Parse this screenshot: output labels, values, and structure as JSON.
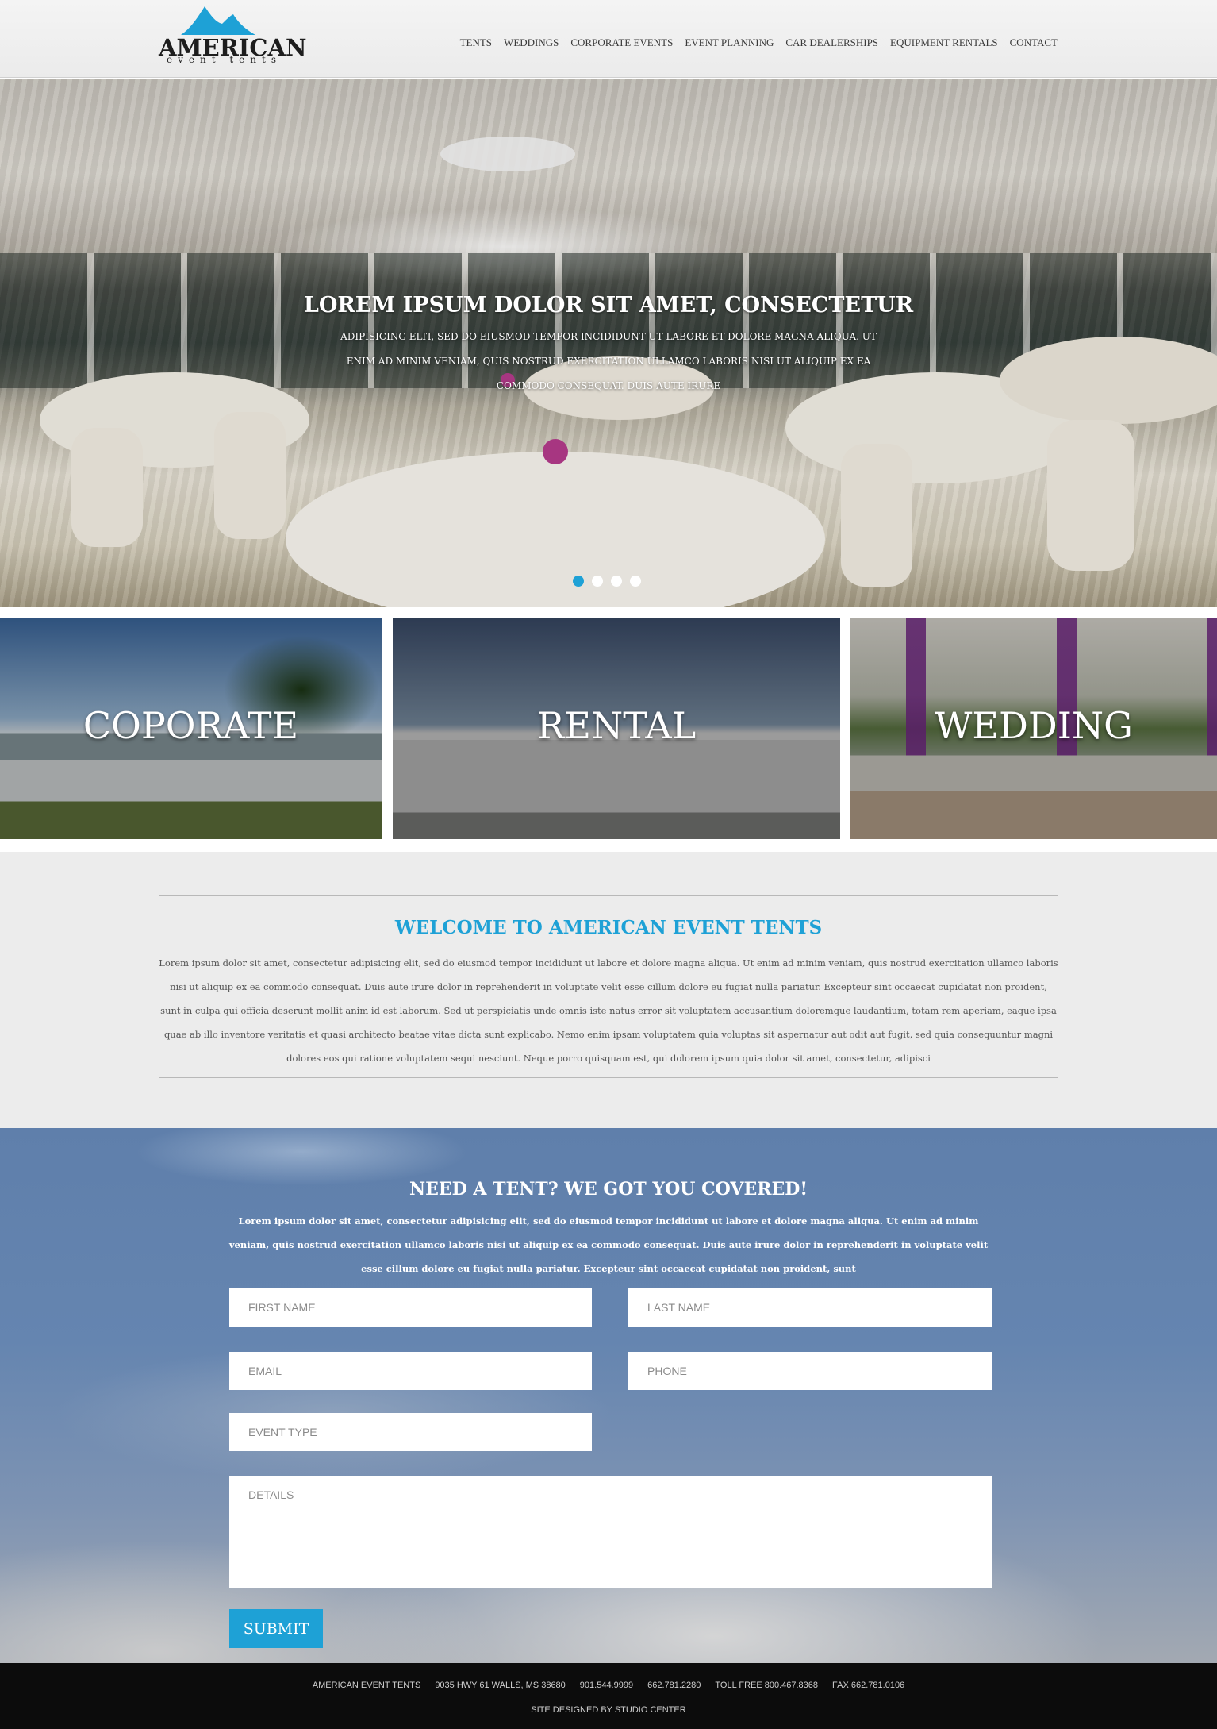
{
  "colors": {
    "accent": "#1ea1d6",
    "footer_bg": "#0c0c0c",
    "section_bg": "#ececec"
  },
  "header": {
    "logo_name": "AMERICAN",
    "logo_sub": "event tents",
    "nav": [
      "TENTS",
      "WEDDINGS",
      "CORPORATE EVENTS",
      "EVENT PLANNING",
      "CAR DEALERSHIPS",
      "EQUIPMENT RENTALS",
      "CONTACT"
    ]
  },
  "hero": {
    "title": "LOREM IPSUM DOLOR SIT AMET, CONSECTETUR",
    "text": "ADIPISICING ELIT, SED DO EIUSMOD TEMPOR INCIDIDUNT UT LABORE ET DOLORE MAGNA ALIQUA. UT ENIM AD MINIM VENIAM, QUIS NOSTRUD EXERCITATION ULLAMCO LABORIS NISI UT ALIQUIP EX EA COMMODO CONSEQUAT. DUIS AUTE IRURE"
  },
  "tiles": [
    "COPORATE",
    "RENTAL",
    "WEDDING"
  ],
  "welcome": {
    "title": "WELCOME TO AMERICAN EVENT TENTS",
    "text": "Lorem ipsum dolor sit amet, consectetur adipisicing elit, sed do eiusmod tempor incididunt ut labore et dolore magna aliqua. Ut enim ad minim veniam, quis nostrud exercitation ullamco laboris nisi ut aliquip ex ea commodo consequat. Duis aute irure dolor in reprehenderit in voluptate velit esse cillum dolore eu fugiat nulla pariatur. Excepteur sint occaecat cupidatat non proident, sunt in culpa qui officia deserunt mollit anim id est laborum. Sed ut perspiciatis unde omnis iste natus error sit voluptatem accusantium doloremque laudantium, totam rem aperiam, eaque ipsa quae ab illo inventore veritatis et quasi architecto beatae vitae dicta sunt explicabo. Nemo enim ipsam voluptatem quia voluptas sit aspernatur aut odit aut fugit, sed quia consequuntur magni dolores eos qui ratione voluptatem sequi nesciunt. Neque porro quisquam est, qui dolorem ipsum quia dolor sit amet, consectetur, adipisci"
  },
  "contact": {
    "title": "NEED A TENT? WE GOT YOU COVERED!",
    "text": "Lorem ipsum dolor sit amet, consectetur adipisicing elit, sed do eiusmod tempor incididunt ut labore et dolore magna aliqua. Ut enim ad minim veniam, quis nostrud exercitation ullamco laboris nisi ut aliquip ex ea commodo consequat. Duis aute irure dolor in reprehenderit in voluptate velit esse cillum dolore eu fugiat nulla pariatur. Excepteur sint occaecat cupidatat non proident, sunt",
    "placeholders": {
      "first_name": "FIRST NAME",
      "last_name": "LAST NAME",
      "email": "EMAIL",
      "phone": "PHONE",
      "event_type": "EVENT TYPE",
      "details": "DETAILS"
    },
    "submit_label": "SUBMIT"
  },
  "footer": {
    "company": "AMERICAN EVENT TENTS",
    "address": "9035 HWY 61 WALLS, MS 38680",
    "phone1": "901.544.9999",
    "phone2": "662.781.2280",
    "toll_free": "TOLL FREE 800.467.8368",
    "fax": "FAX 662.781.0106",
    "credit": "SITE DESIGNED BY STUDIO CENTER"
  }
}
